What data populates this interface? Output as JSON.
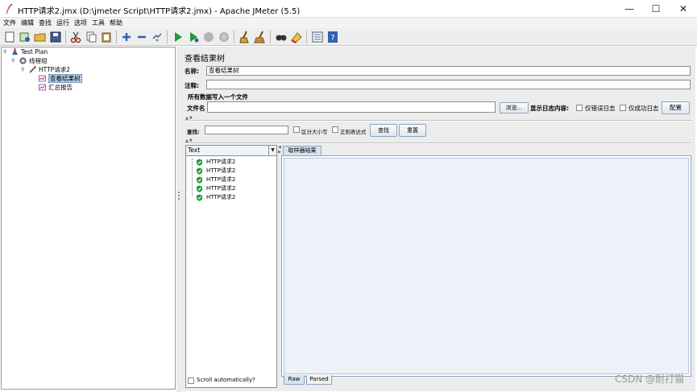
{
  "window": {
    "title": "HTTP请求2.jmx (D:\\jmeter Script\\HTTP请求2.jmx) - Apache JMeter (5.5)",
    "minimize": "—",
    "maximize": "☐",
    "close": "✕"
  },
  "menu": [
    "文件",
    "编辑",
    "查找",
    "运行",
    "选项",
    "工具",
    "帮助"
  ],
  "toolbar": [
    "new-icon",
    "templates-icon",
    "open-icon",
    "save-icon",
    "cut-icon",
    "copy-icon",
    "paste-icon",
    "expand-icon",
    "collapse-icon",
    "toggle-icon",
    "start-icon",
    "start-no-pause-icon",
    "stop-icon",
    "shutdown-icon",
    "clear-icon",
    "clear-all-icon",
    "search-icon",
    "reset-search-icon",
    "function-helper-icon",
    "help-icon"
  ],
  "tree": {
    "root": "Test Plan",
    "thread_group": "线程组",
    "sampler": "HTTP请求2",
    "listener_selected": "查看结果树",
    "listener_other": "汇总报告"
  },
  "panel": {
    "title": "查看结果树",
    "name_label": "名称:",
    "name_value": "查看结果树",
    "comment_label": "注释:",
    "comment_value": "",
    "file_section": "所有数据写入一个文件",
    "filename_label": "文件名",
    "filename_value": "",
    "browse_button": "浏览...",
    "log_label": "显示日志内容:",
    "errors_only": "仅错误日志",
    "success_only": "仅成功日志",
    "configure_button": "配置",
    "search_label": "查找:",
    "case_sensitive": "区分大小写",
    "regex": "正则表达式",
    "find_button": "查找",
    "reset_button": "重置"
  },
  "results": {
    "renderer": "Text",
    "items": [
      "HTTP请求2",
      "HTTP请求2",
      "HTTP请求2",
      "HTTP请求2",
      "HTTP请求2"
    ],
    "scroll_auto": "Scroll automatically?",
    "tab_sampler_result": "取样器结果",
    "tab_raw": "Raw",
    "tab_parsed": "Parsed"
  },
  "watermark": "CSDN @耐打猫",
  "colors": {
    "selection": "#b8cfe5",
    "success_shield": "#1e9a3a",
    "accent_blue": "#2f62b0"
  }
}
